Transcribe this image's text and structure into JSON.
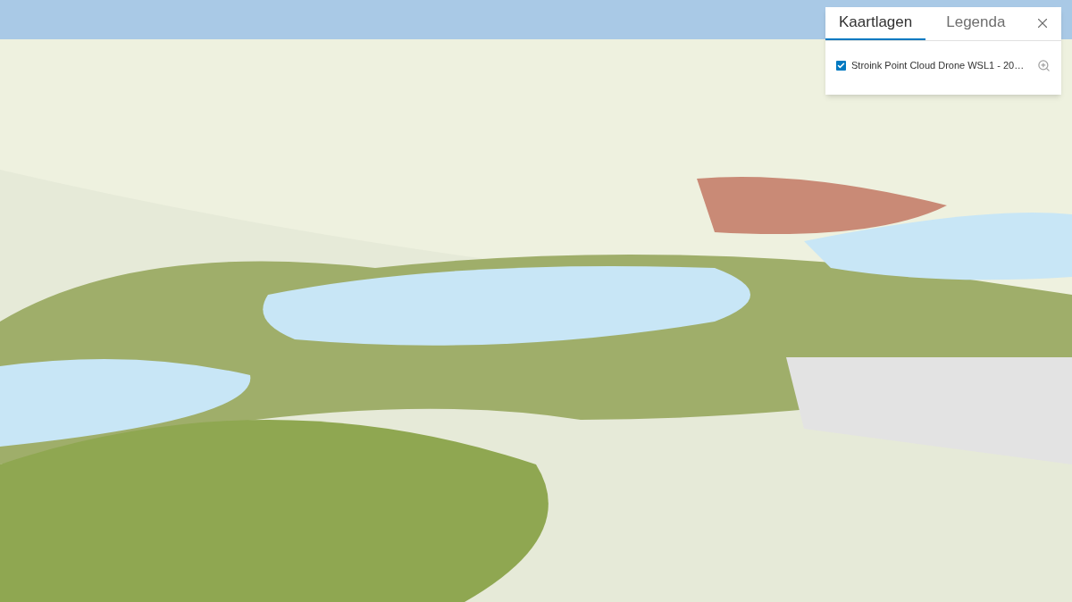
{
  "panel": {
    "tabs": [
      {
        "label": "Kaartlagen",
        "selected": true
      },
      {
        "label": "Legenda",
        "selected": false
      }
    ],
    "layers": [
      {
        "title": "Stroink Point Cloud Drone WSL1 - 20…",
        "checked": true
      }
    ]
  }
}
